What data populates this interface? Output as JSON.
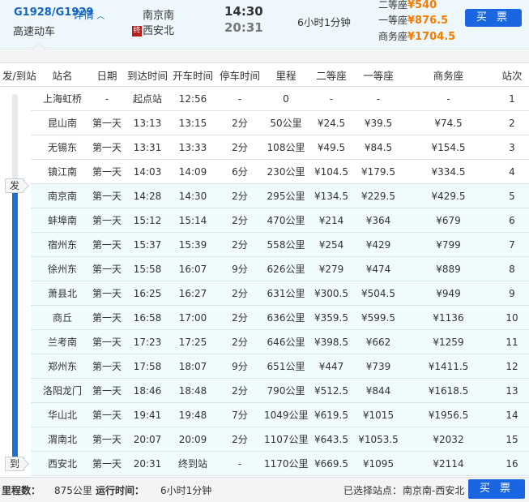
{
  "train": {
    "number": "G1928/G1929",
    "detail_label": "详情",
    "type": "高速动车",
    "from": "南京南",
    "to": "西安北",
    "end_badge": "终",
    "depart": "14:30",
    "arrive": "20:31",
    "duration": "6小时1分钟",
    "prices": [
      {
        "label": "二等座",
        "value": "¥540"
      },
      {
        "label": "一等座",
        "value": "¥876.5"
      },
      {
        "label": "商务座",
        "value": "¥1704.5"
      }
    ],
    "buy_label": "买 票"
  },
  "table": {
    "headers": [
      "发/到站",
      "站名",
      "日期",
      "到达时间",
      "开车时间",
      "停车时间",
      "里程",
      "二等座",
      "一等座",
      "商务座",
      "站次"
    ],
    "depart_tag": "发",
    "arrive_tag": "到",
    "rows": [
      [
        "上海虹桥",
        "-",
        "起点站",
        "12:56",
        "-",
        "0",
        "-",
        "-",
        "-",
        "1"
      ],
      [
        "昆山南",
        "第一天",
        "13:13",
        "13:15",
        "2分",
        "50公里",
        "¥24.5",
        "¥39.5",
        "¥74.5",
        "2"
      ],
      [
        "无锡东",
        "第一天",
        "13:31",
        "13:33",
        "2分",
        "108公里",
        "¥49.5",
        "¥84.5",
        "¥154.5",
        "3"
      ],
      [
        "镇江南",
        "第一天",
        "14:03",
        "14:09",
        "6分",
        "230公里",
        "¥104.5",
        "¥179.5",
        "¥334.5",
        "4"
      ],
      [
        "南京南",
        "第一天",
        "14:28",
        "14:30",
        "2分",
        "295公里",
        "¥134.5",
        "¥229.5",
        "¥429.5",
        "5"
      ],
      [
        "蚌埠南",
        "第一天",
        "15:12",
        "15:14",
        "2分",
        "470公里",
        "¥214",
        "¥364",
        "¥679",
        "6"
      ],
      [
        "宿州东",
        "第一天",
        "15:37",
        "15:39",
        "2分",
        "558公里",
        "¥254",
        "¥429",
        "¥799",
        "7"
      ],
      [
        "徐州东",
        "第一天",
        "15:58",
        "16:07",
        "9分",
        "626公里",
        "¥279",
        "¥474",
        "¥889",
        "8"
      ],
      [
        "萧县北",
        "第一天",
        "16:25",
        "16:27",
        "2分",
        "631公里",
        "¥300.5",
        "¥504.5",
        "¥949",
        "9"
      ],
      [
        "商丘",
        "第一天",
        "16:58",
        "17:00",
        "2分",
        "636公里",
        "¥359.5",
        "¥599.5",
        "¥1136",
        "10"
      ],
      [
        "兰考南",
        "第一天",
        "17:23",
        "17:25",
        "2分",
        "646公里",
        "¥398.5",
        "¥662",
        "¥1259",
        "11"
      ],
      [
        "郑州东",
        "第一天",
        "17:58",
        "18:07",
        "9分",
        "651公里",
        "¥447",
        "¥739",
        "¥1411.5",
        "12"
      ],
      [
        "洛阳龙门",
        "第一天",
        "18:46",
        "18:48",
        "2分",
        "790公里",
        "¥512.5",
        "¥844",
        "¥1618.5",
        "13"
      ],
      [
        "华山北",
        "第一天",
        "19:41",
        "19:48",
        "7分",
        "1049公里",
        "¥619.5",
        "¥1015",
        "¥1956.5",
        "14"
      ],
      [
        "渭南北",
        "第一天",
        "20:07",
        "20:09",
        "2分",
        "1107公里",
        "¥643.5",
        "¥1053.5",
        "¥2032",
        "15"
      ],
      [
        "西安北",
        "第一天",
        "20:31",
        "终到站",
        "-",
        "1170公里",
        "¥669.5",
        "¥1095",
        "¥2114",
        "16"
      ]
    ]
  },
  "footer": {
    "mileage_label": "里程数：",
    "mileage": "875公里",
    "runtime_label": "运行时间：",
    "runtime": "6小时1分钟",
    "selected_label": "已选择站点：",
    "selected": "南京南-西安北",
    "buy_label": "买 票"
  },
  "colors": {
    "accent": "#1a66e0",
    "price": "#f57c00",
    "highlight_row": "#f0fbfc"
  }
}
